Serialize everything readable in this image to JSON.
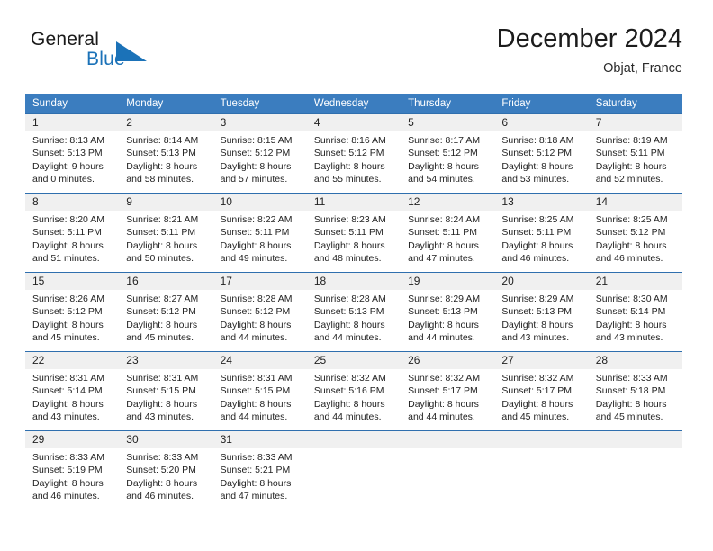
{
  "logo": {
    "primary_text": "General",
    "secondary_text": "Blue",
    "icon": "triangle-flag-icon",
    "primary_color": "#1a1a1a",
    "secondary_color": "#1b72b8"
  },
  "header": {
    "title": "December 2024",
    "subtitle": "Objat, France"
  },
  "theme": {
    "header_bar_color": "#3b7dbf",
    "row_divider_color": "#2f6fae",
    "day_strip_color": "#f0f0f0",
    "text_color": "#232323"
  },
  "weekdays": [
    "Sunday",
    "Monday",
    "Tuesday",
    "Wednesday",
    "Thursday",
    "Friday",
    "Saturday"
  ],
  "weeks": [
    [
      {
        "day": "1",
        "sunrise": "Sunrise: 8:13 AM",
        "sunset": "Sunset: 5:13 PM",
        "daylight_line1": "Daylight: 9 hours",
        "daylight_line2": "and 0 minutes."
      },
      {
        "day": "2",
        "sunrise": "Sunrise: 8:14 AM",
        "sunset": "Sunset: 5:13 PM",
        "daylight_line1": "Daylight: 8 hours",
        "daylight_line2": "and 58 minutes."
      },
      {
        "day": "3",
        "sunrise": "Sunrise: 8:15 AM",
        "sunset": "Sunset: 5:12 PM",
        "daylight_line1": "Daylight: 8 hours",
        "daylight_line2": "and 57 minutes."
      },
      {
        "day": "4",
        "sunrise": "Sunrise: 8:16 AM",
        "sunset": "Sunset: 5:12 PM",
        "daylight_line1": "Daylight: 8 hours",
        "daylight_line2": "and 55 minutes."
      },
      {
        "day": "5",
        "sunrise": "Sunrise: 8:17 AM",
        "sunset": "Sunset: 5:12 PM",
        "daylight_line1": "Daylight: 8 hours",
        "daylight_line2": "and 54 minutes."
      },
      {
        "day": "6",
        "sunrise": "Sunrise: 8:18 AM",
        "sunset": "Sunset: 5:12 PM",
        "daylight_line1": "Daylight: 8 hours",
        "daylight_line2": "and 53 minutes."
      },
      {
        "day": "7",
        "sunrise": "Sunrise: 8:19 AM",
        "sunset": "Sunset: 5:11 PM",
        "daylight_line1": "Daylight: 8 hours",
        "daylight_line2": "and 52 minutes."
      }
    ],
    [
      {
        "day": "8",
        "sunrise": "Sunrise: 8:20 AM",
        "sunset": "Sunset: 5:11 PM",
        "daylight_line1": "Daylight: 8 hours",
        "daylight_line2": "and 51 minutes."
      },
      {
        "day": "9",
        "sunrise": "Sunrise: 8:21 AM",
        "sunset": "Sunset: 5:11 PM",
        "daylight_line1": "Daylight: 8 hours",
        "daylight_line2": "and 50 minutes."
      },
      {
        "day": "10",
        "sunrise": "Sunrise: 8:22 AM",
        "sunset": "Sunset: 5:11 PM",
        "daylight_line1": "Daylight: 8 hours",
        "daylight_line2": "and 49 minutes."
      },
      {
        "day": "11",
        "sunrise": "Sunrise: 8:23 AM",
        "sunset": "Sunset: 5:11 PM",
        "daylight_line1": "Daylight: 8 hours",
        "daylight_line2": "and 48 minutes."
      },
      {
        "day": "12",
        "sunrise": "Sunrise: 8:24 AM",
        "sunset": "Sunset: 5:11 PM",
        "daylight_line1": "Daylight: 8 hours",
        "daylight_line2": "and 47 minutes."
      },
      {
        "day": "13",
        "sunrise": "Sunrise: 8:25 AM",
        "sunset": "Sunset: 5:11 PM",
        "daylight_line1": "Daylight: 8 hours",
        "daylight_line2": "and 46 minutes."
      },
      {
        "day": "14",
        "sunrise": "Sunrise: 8:25 AM",
        "sunset": "Sunset: 5:12 PM",
        "daylight_line1": "Daylight: 8 hours",
        "daylight_line2": "and 46 minutes."
      }
    ],
    [
      {
        "day": "15",
        "sunrise": "Sunrise: 8:26 AM",
        "sunset": "Sunset: 5:12 PM",
        "daylight_line1": "Daylight: 8 hours",
        "daylight_line2": "and 45 minutes."
      },
      {
        "day": "16",
        "sunrise": "Sunrise: 8:27 AM",
        "sunset": "Sunset: 5:12 PM",
        "daylight_line1": "Daylight: 8 hours",
        "daylight_line2": "and 45 minutes."
      },
      {
        "day": "17",
        "sunrise": "Sunrise: 8:28 AM",
        "sunset": "Sunset: 5:12 PM",
        "daylight_line1": "Daylight: 8 hours",
        "daylight_line2": "and 44 minutes."
      },
      {
        "day": "18",
        "sunrise": "Sunrise: 8:28 AM",
        "sunset": "Sunset: 5:13 PM",
        "daylight_line1": "Daylight: 8 hours",
        "daylight_line2": "and 44 minutes."
      },
      {
        "day": "19",
        "sunrise": "Sunrise: 8:29 AM",
        "sunset": "Sunset: 5:13 PM",
        "daylight_line1": "Daylight: 8 hours",
        "daylight_line2": "and 44 minutes."
      },
      {
        "day": "20",
        "sunrise": "Sunrise: 8:29 AM",
        "sunset": "Sunset: 5:13 PM",
        "daylight_line1": "Daylight: 8 hours",
        "daylight_line2": "and 43 minutes."
      },
      {
        "day": "21",
        "sunrise": "Sunrise: 8:30 AM",
        "sunset": "Sunset: 5:14 PM",
        "daylight_line1": "Daylight: 8 hours",
        "daylight_line2": "and 43 minutes."
      }
    ],
    [
      {
        "day": "22",
        "sunrise": "Sunrise: 8:31 AM",
        "sunset": "Sunset: 5:14 PM",
        "daylight_line1": "Daylight: 8 hours",
        "daylight_line2": "and 43 minutes."
      },
      {
        "day": "23",
        "sunrise": "Sunrise: 8:31 AM",
        "sunset": "Sunset: 5:15 PM",
        "daylight_line1": "Daylight: 8 hours",
        "daylight_line2": "and 43 minutes."
      },
      {
        "day": "24",
        "sunrise": "Sunrise: 8:31 AM",
        "sunset": "Sunset: 5:15 PM",
        "daylight_line1": "Daylight: 8 hours",
        "daylight_line2": "and 44 minutes."
      },
      {
        "day": "25",
        "sunrise": "Sunrise: 8:32 AM",
        "sunset": "Sunset: 5:16 PM",
        "daylight_line1": "Daylight: 8 hours",
        "daylight_line2": "and 44 minutes."
      },
      {
        "day": "26",
        "sunrise": "Sunrise: 8:32 AM",
        "sunset": "Sunset: 5:17 PM",
        "daylight_line1": "Daylight: 8 hours",
        "daylight_line2": "and 44 minutes."
      },
      {
        "day": "27",
        "sunrise": "Sunrise: 8:32 AM",
        "sunset": "Sunset: 5:17 PM",
        "daylight_line1": "Daylight: 8 hours",
        "daylight_line2": "and 45 minutes."
      },
      {
        "day": "28",
        "sunrise": "Sunrise: 8:33 AM",
        "sunset": "Sunset: 5:18 PM",
        "daylight_line1": "Daylight: 8 hours",
        "daylight_line2": "and 45 minutes."
      }
    ],
    [
      {
        "day": "29",
        "sunrise": "Sunrise: 8:33 AM",
        "sunset": "Sunset: 5:19 PM",
        "daylight_line1": "Daylight: 8 hours",
        "daylight_line2": "and 46 minutes."
      },
      {
        "day": "30",
        "sunrise": "Sunrise: 8:33 AM",
        "sunset": "Sunset: 5:20 PM",
        "daylight_line1": "Daylight: 8 hours",
        "daylight_line2": "and 46 minutes."
      },
      {
        "day": "31",
        "sunrise": "Sunrise: 8:33 AM",
        "sunset": "Sunset: 5:21 PM",
        "daylight_line1": "Daylight: 8 hours",
        "daylight_line2": "and 47 minutes."
      },
      {
        "day": "",
        "sunrise": "",
        "sunset": "",
        "daylight_line1": "",
        "daylight_line2": ""
      },
      {
        "day": "",
        "sunrise": "",
        "sunset": "",
        "daylight_line1": "",
        "daylight_line2": ""
      },
      {
        "day": "",
        "sunrise": "",
        "sunset": "",
        "daylight_line1": "",
        "daylight_line2": ""
      },
      {
        "day": "",
        "sunrise": "",
        "sunset": "",
        "daylight_line1": "",
        "daylight_line2": ""
      }
    ]
  ]
}
